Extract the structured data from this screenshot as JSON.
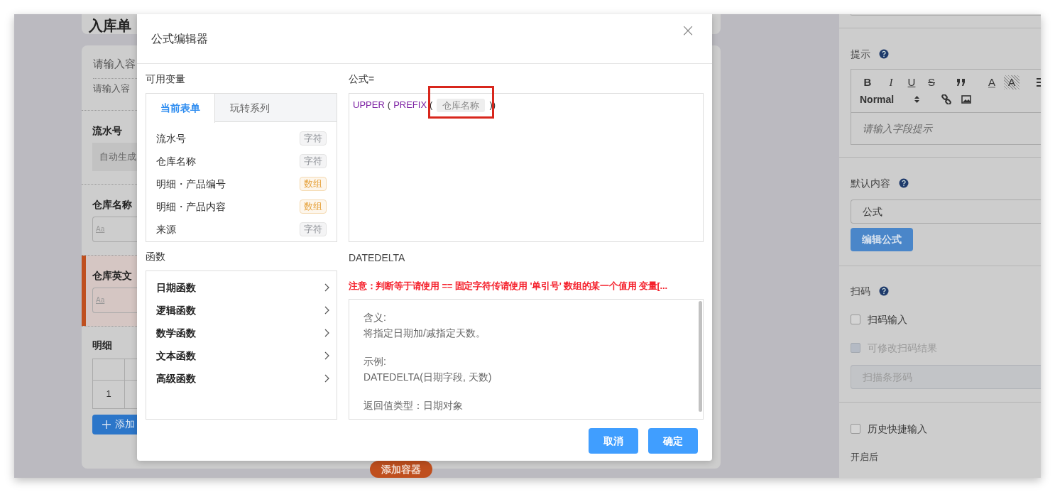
{
  "background_form": {
    "title": "入库单",
    "container_title": "请输入容",
    "container_hint": "请输入容",
    "fields": [
      {
        "label": "流水号",
        "kind": "auto",
        "value": "自动生成",
        "selected": false
      },
      {
        "label": "仓库名称",
        "kind": "text",
        "placeholder": "Aa",
        "selected": false
      },
      {
        "label": "仓库英文",
        "kind": "text",
        "placeholder": "Aa",
        "selected": true
      }
    ],
    "detail": {
      "label": "明细",
      "row_number": "1",
      "add_button": "添加"
    },
    "add_container_button": "添加容器"
  },
  "dialog": {
    "title": "公式编辑器",
    "close": "×",
    "variables": {
      "label": "可用变量",
      "tabs": [
        {
          "label": "当前表单",
          "selected": true
        },
        {
          "label": "玩转系列",
          "selected": false
        }
      ],
      "items": [
        {
          "name": "流水号",
          "type": "字符",
          "kind": "string"
        },
        {
          "name": "仓库名称",
          "type": "字符",
          "kind": "string"
        },
        {
          "name": "明细・产品编号",
          "type": "数组",
          "kind": "array"
        },
        {
          "name": "明细・产品内容",
          "type": "数组",
          "kind": "array"
        },
        {
          "name": "来源",
          "type": "字符",
          "kind": "string"
        }
      ]
    },
    "functions": {
      "label": "函数",
      "items": [
        {
          "name": "日期函数"
        },
        {
          "name": "逻辑函数"
        },
        {
          "name": "数学函数"
        },
        {
          "name": "文本函数"
        },
        {
          "name": "高级函数"
        }
      ]
    },
    "formula": {
      "label": "公式=",
      "tokens": [
        {
          "kind": "function",
          "text": "UPPER"
        },
        {
          "kind": "paren",
          "text": "("
        },
        {
          "kind": "function",
          "text": "PREFIX"
        },
        {
          "kind": "paren",
          "text": "("
        },
        {
          "kind": "field",
          "text": "仓库名称",
          "highlighted": true
        },
        {
          "kind": "paren",
          "text": "))"
        }
      ]
    },
    "function_name": "DATEDELTA",
    "notice": "注意：判断等于请使用 == 固定字符传请使用 '单引号' 数组的某一个值用 变量[...",
    "description": [
      [
        "含义:",
        "将指定日期加/减指定天数。"
      ],
      [
        "示例:",
        "DATEDELTA(日期字段, 天数)"
      ],
      [
        "返回值类型：日期对象"
      ]
    ],
    "buttons": [
      {
        "label": "取消"
      },
      {
        "label": "确定"
      }
    ]
  },
  "properties_panel": {
    "hint": {
      "label": "提示",
      "toolbar": [
        {
          "kind": "bold",
          "label": "B"
        },
        {
          "kind": "italic",
          "label": "I"
        },
        {
          "kind": "underline",
          "label": "U"
        },
        {
          "kind": "strike",
          "label": "S"
        },
        {
          "kind": "quote"
        },
        {
          "kind": "color",
          "label": "A"
        },
        {
          "kind": "background",
          "label": "A"
        },
        {
          "kind": "list"
        }
      ],
      "header_select": "Normal",
      "toolbar_2": [
        {
          "kind": "link"
        },
        {
          "kind": "image"
        }
      ],
      "placeholder": "请输入字段提示"
    },
    "default_value": {
      "label": "默认内容",
      "select": "公式",
      "button": "编辑公式"
    },
    "scan": {
      "label": "扫码",
      "options": [
        {
          "label": "扫码输入",
          "checked": false,
          "disabled": false
        },
        {
          "label": "可修改扫码结果",
          "checked": false,
          "disabled": true
        }
      ],
      "placeholder": "扫描条形码"
    },
    "history": {
      "label": "历史快捷输入",
      "checked": false,
      "note": "开启后"
    }
  }
}
